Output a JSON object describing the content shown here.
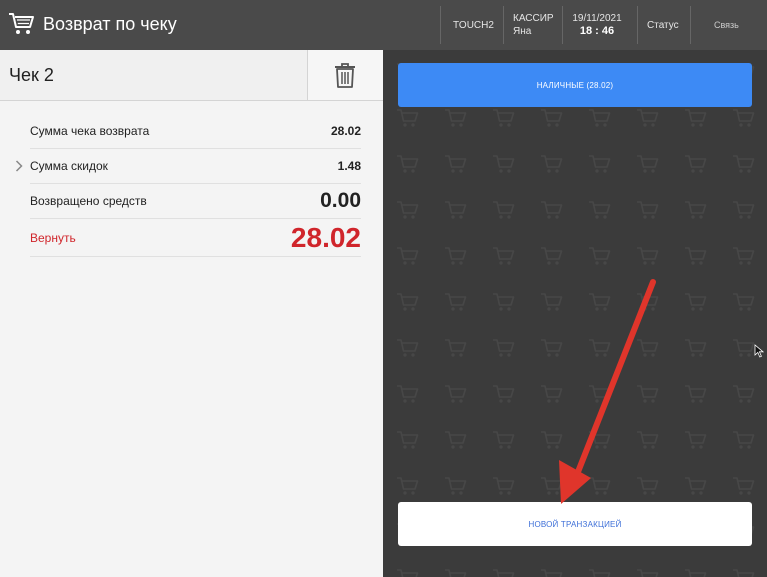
{
  "header": {
    "title": "Возврат по чеку",
    "terminal": "TOUCH2",
    "cashier_label": "КАССИР",
    "cashier_name": "Яна",
    "date": "19/11/2021",
    "time": "18 : 46",
    "status_label": "Статус",
    "link_label": "Связь",
    "icon": "cart-icon"
  },
  "check": {
    "title": "Чек 2",
    "delete_icon": "trash-icon"
  },
  "summary": {
    "refund_total_label": "Сумма чека возврата",
    "refund_total_value": "28.02",
    "discount_label": "Сумма скидок",
    "discount_value": "1.48",
    "returned_label": "Возвращено средств",
    "returned_value": "0.00",
    "to_return_label": "Вернуть",
    "to_return_value": "28.02"
  },
  "payment": {
    "cash_button_label": "НАЛИЧНЫЕ (28.02)",
    "new_transaction_label": "НОВОЙ ТРАНЗАКЦИЕЙ"
  },
  "colors": {
    "header_bg": "#4a4a4a",
    "accent_blue": "#3d8af5",
    "refund_red": "#d0252b",
    "annotation_arrow": "#e0352b"
  }
}
